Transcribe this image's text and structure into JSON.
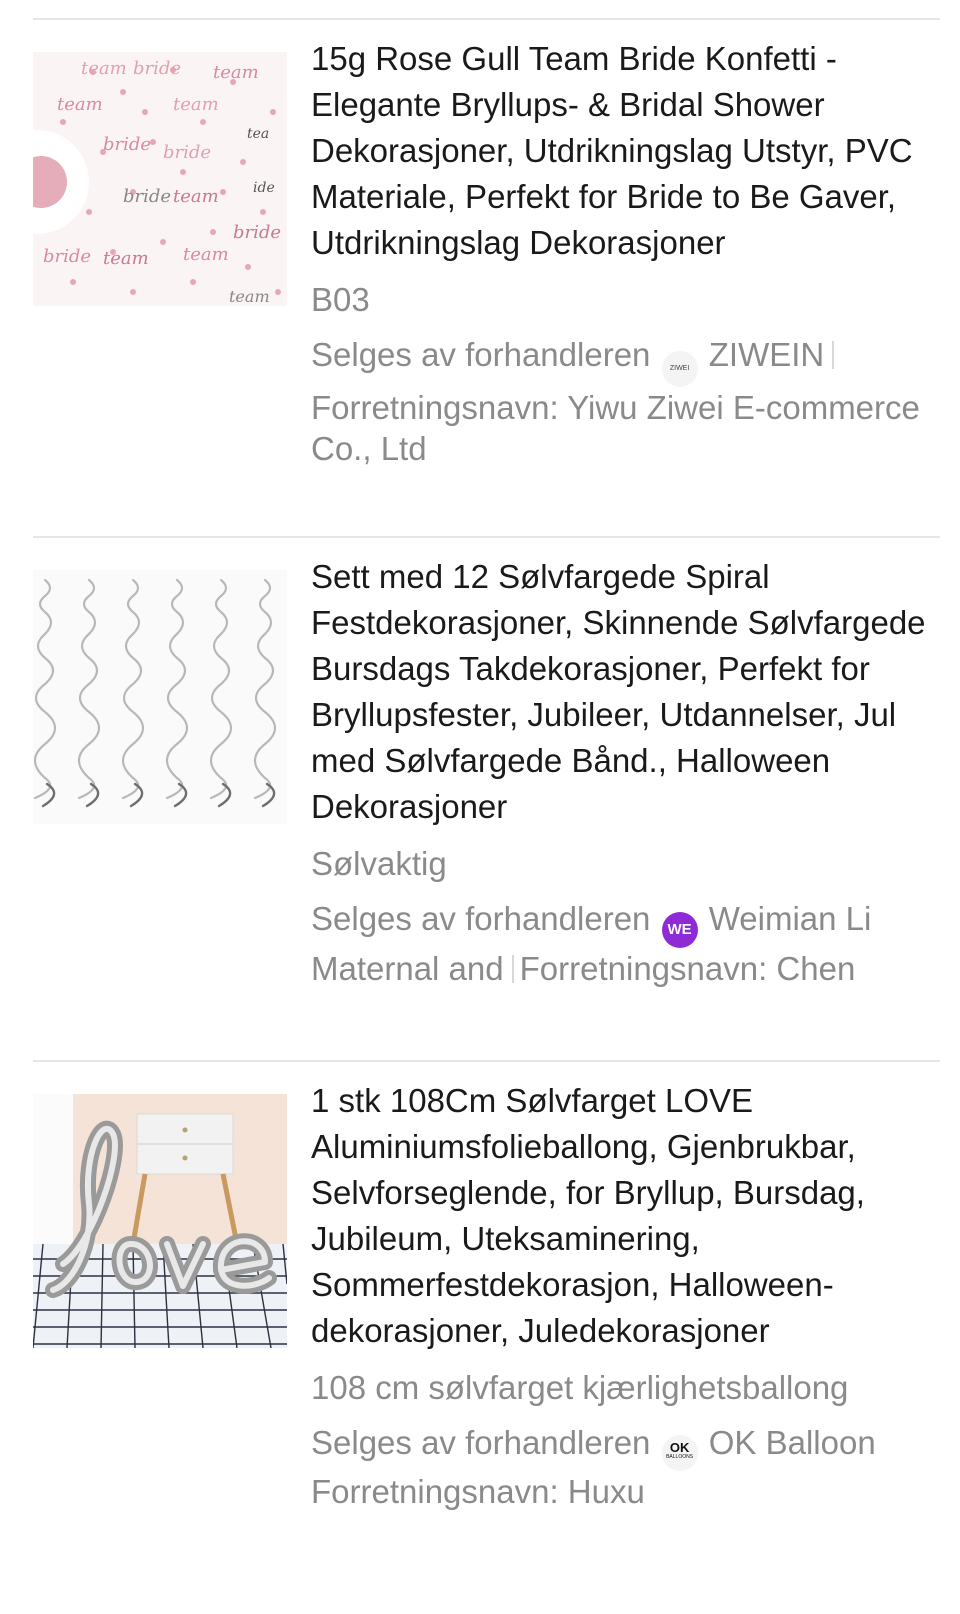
{
  "products": [
    {
      "title": "15g Rose Gull Team Bride Konfetti - Elegante Bryllups- & Bridal Shower Dekorasjoner, Utdrikningslag Utstyr, PVC Materiale, Perfekt for Bride to Be Gaver, Utdrikningslag Dekorasjoner",
      "variant": "B03",
      "seller_prefix": "Selges av forhandleren",
      "seller_logo_text": "ZIWEI",
      "seller_name": "ZIWEIN",
      "business_line": "Forretningsnavn: Yiwu Ziwei E-commerce",
      "business_line2": "Co., Ltd",
      "image_icon": "confetti-image"
    },
    {
      "title": "Sett med 12 Sølvfargede Spiral Festdekorasjoner, Skinnende Sølvfargede Bursdags Takdekorasjoner, Perfekt for Bryllupsfester, Jubileer, Utdannelser, Jul med Sølvfargede Bånd., Halloween Dekorasjoner",
      "variant": "Sølvaktig",
      "seller_prefix": "Selges av forhandleren",
      "seller_logo_text": "WE",
      "seller_name": "Weimian Li",
      "business_line_a": "Maternal and",
      "business_line_b": "Forretningsnavn: Chen",
      "image_icon": "spiral-image"
    },
    {
      "title": "1 stk 108Cm Sølvfarget LOVE Aluminiumsfolieballong, Gjenbrukbar, Selvforseglende, for Bryllup, Bursdag, Jubileum, Uteksaminering, Sommerfestdekorasjon, Halloween-dekorasjoner, Juledekorasjoner",
      "variant": "108 cm sølvfarget kjærlighetsballong",
      "seller_prefix": "Selges av forhandleren",
      "seller_logo_text": "OK",
      "seller_logo_sub": "BALLOONS",
      "seller_name": "OK Balloon",
      "business_line": "Forretningsnavn: Huxu",
      "image_icon": "love-balloon-image"
    }
  ],
  "colors": {
    "title": "#1a1a1a",
    "secondary": "#8a8a8a",
    "divider": "#e6e6e6",
    "we_badge": "#8e2bd6"
  }
}
